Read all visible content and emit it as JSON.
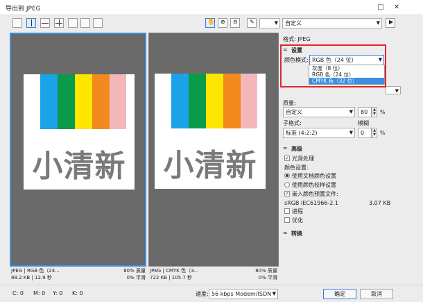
{
  "window": {
    "title": "导出到 JPEG"
  },
  "toolbar": {
    "preset_value": "自定义",
    "zoom_value": ""
  },
  "preview_left": {
    "bar_colors": [
      "#ffffff",
      "#1aa3e8",
      "#0b9a4a",
      "#ffe600",
      "#f28a1e",
      "#f4b8bb",
      "#ffffff"
    ],
    "caption": "小清新",
    "info_line1": "JPEG | RGB 色（24...",
    "info_line2": "88.2 KB | 12.9 秒",
    "quality_line1": "80% 质量",
    "quality_line2": "0% 平滑"
  },
  "preview_right": {
    "bar_colors": [
      "#ffffff",
      "#1aa3e8",
      "#0b9a4a",
      "#ffe600",
      "#f28a1e",
      "#f4b8bb",
      "#ffffff"
    ],
    "caption": "小清新",
    "info_line1": "JPEG | CMYK 色（3...",
    "info_line2": "722 KB | 105.7 秒",
    "quality_line1": "80% 质量",
    "quality_line2": "0% 平滑"
  },
  "panel": {
    "format_label": "格式: JPEG",
    "settings_header": "设置",
    "color_mode_label": "颜色模式:",
    "color_mode_value": "RGB 色（24 位）",
    "color_mode_options": [
      "灰度（8 位）",
      "RGB 色（24 位）",
      "CMYK 色（32 位）"
    ],
    "color_mode_highlighted": "CMYK 色（32 位）",
    "quality_label": "质量:",
    "quality_preset": "自定义",
    "quality_value": "80",
    "percent": "%",
    "subformat_label": "子格式:",
    "smoothing_label": "模糊",
    "subformat_value": "标准 (4:2:2)",
    "smoothing_value": "0",
    "advanced_header": "高级",
    "anti_alias": "光滑处理",
    "color_settings_label": "颜色设置:",
    "use_document_color": "使用文档颜色设置",
    "use_proof_color": "使用颜色校样设置",
    "embed_profile": "嵌入颜色预置文件:",
    "profile_name": "sRGB IEC61966-2.1",
    "profile_size": "3.07 KB",
    "progressive": "进程",
    "optimize": "优化",
    "transform_header": "转换"
  },
  "status": {
    "c": "C: 0",
    "m": "M: 0",
    "y": "Y: 0",
    "k": "K: 0",
    "speed_label": "速度:",
    "speed_value": "56 kbps Modem/ISDN",
    "ok": "确定",
    "cancel": "取消"
  }
}
